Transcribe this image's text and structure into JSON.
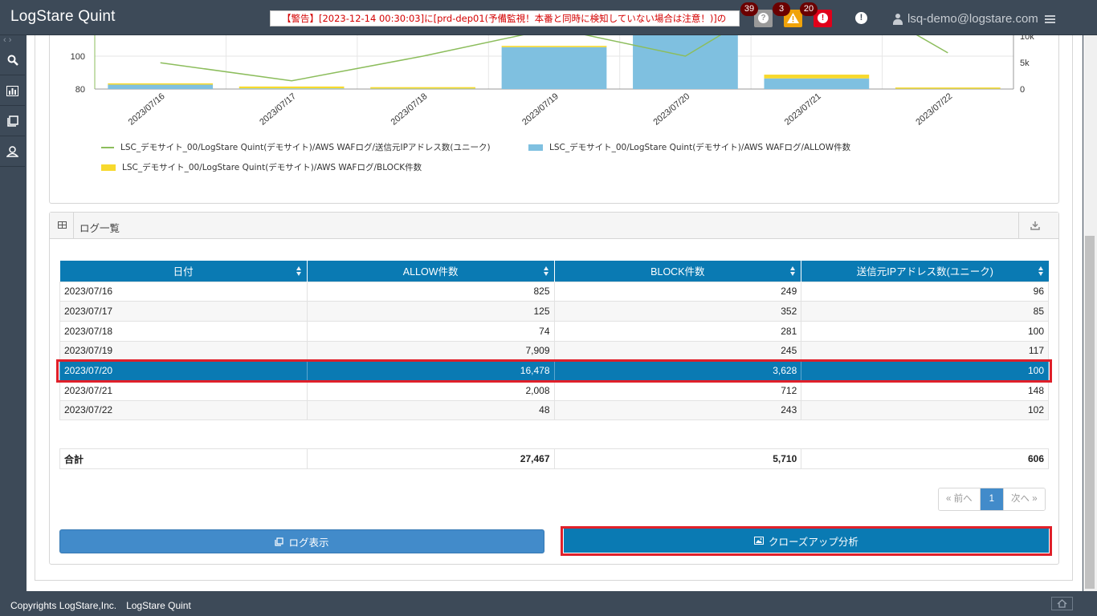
{
  "app": {
    "title": "LogStare Quint"
  },
  "alert": {
    "text": "【警告】[2023-12-14 00:30:03]に[prd-dep01(予備監視！本番と同時に検知していない場合は注意！)]の"
  },
  "status": {
    "unknown_count": "39",
    "warning_count": "3",
    "critical_count": "20",
    "unknown_color": "#9a9a9a",
    "warning_color": "#f0a30a",
    "critical_color": "#e0001a"
  },
  "user": {
    "name": "lsq-demo@logstare.com"
  },
  "chart_data": {
    "type": "bar",
    "categories": [
      "2023/07/16",
      "2023/07/17",
      "2023/07/18",
      "2023/07/19",
      "2023/07/20",
      "2023/07/21",
      "2023/07/22"
    ],
    "series": [
      {
        "name": "LSC_デモサイト_00/LogStare Quint(デモサイト)/AWS WAFログ/ALLOW件数",
        "kind": "bar",
        "axis": "right",
        "color": "#7fc0e0",
        "values": [
          825,
          125,
          74,
          7909,
          16478,
          2008,
          48
        ]
      },
      {
        "name": "LSC_デモサイト_00/LogStare Quint(デモサイト)/AWS WAFログ/BLOCK件数",
        "kind": "bar",
        "axis": "right",
        "color": "#f7d92d",
        "values": [
          249,
          352,
          281,
          245,
          3628,
          712,
          243
        ]
      },
      {
        "name": "LSC_デモサイト_00/LogStare Quint(デモサイト)/AWS WAFログ/送信元IPアドレス数(ユニーク)",
        "kind": "line",
        "axis": "left",
        "color": "#8cbd5c",
        "values": [
          96,
          85,
          100,
          117,
          100,
          148,
          102
        ]
      }
    ],
    "left_ticks": [
      "80",
      "100"
    ],
    "right_ticks": [
      "0",
      "5k",
      "10k"
    ],
    "ylim_left": [
      80,
      120
    ],
    "ylim_right": [
      0,
      10000
    ]
  },
  "legend": {
    "line_label": "LSC_デモサイト_00/LogStare Quint(デモサイト)/AWS WAFログ/送信元IPアドレス数(ユニーク)",
    "allow_label": "LSC_デモサイト_00/LogStare Quint(デモサイト)/AWS WAFログ/ALLOW件数",
    "block_label": "LSC_デモサイト_00/LogStare Quint(デモサイト)/AWS WAFログ/BLOCK件数"
  },
  "log_panel": {
    "title": "ログ一覧"
  },
  "table": {
    "headers": [
      "日付",
      "ALLOW件数",
      "BLOCK件数",
      "送信元IPアドレス数(ユニーク)"
    ],
    "rows": [
      [
        "2023/07/16",
        "825",
        "249",
        "96"
      ],
      [
        "2023/07/17",
        "125",
        "352",
        "85"
      ],
      [
        "2023/07/18",
        "74",
        "281",
        "100"
      ],
      [
        "2023/07/19",
        "7,909",
        "245",
        "117"
      ],
      [
        "2023/07/20",
        "16,478",
        "3,628",
        "100"
      ],
      [
        "2023/07/21",
        "2,008",
        "712",
        "148"
      ],
      [
        "2023/07/22",
        "48",
        "243",
        "102"
      ]
    ],
    "selected_row": 4,
    "total": [
      "合計",
      "27,467",
      "5,710",
      "606"
    ]
  },
  "pager": {
    "prev": "« 前へ",
    "current": "1",
    "next": "次へ »"
  },
  "buttons": {
    "log_view": "ログ表示",
    "closeup": "クローズアップ分析"
  },
  "footer": {
    "copyright": "Copyrights LogStare,Inc.　LogStare Quint"
  }
}
